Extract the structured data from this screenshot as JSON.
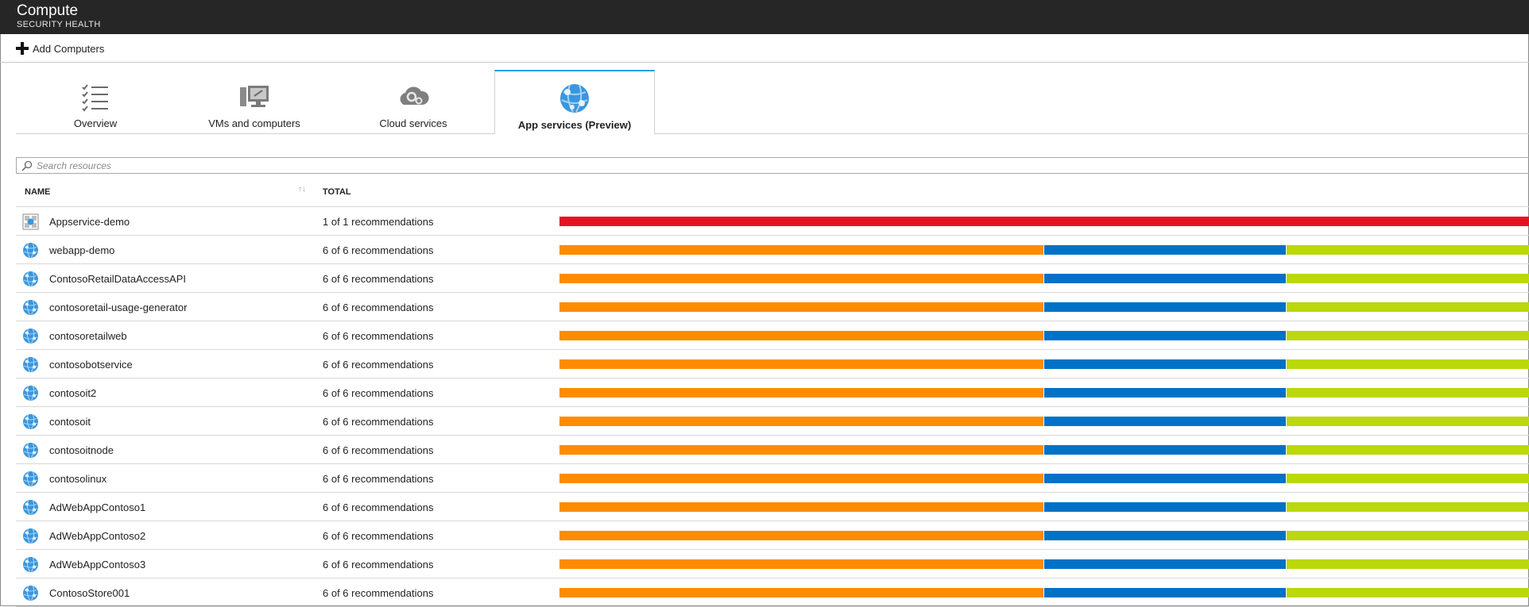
{
  "header": {
    "title": "Compute",
    "subtitle": "SECURITY HEALTH"
  },
  "toolbar": {
    "add_label": "Add Computers"
  },
  "tabs": [
    {
      "label": "Overview",
      "icon": "checklist-icon",
      "active": false
    },
    {
      "label": "VMs and computers",
      "icon": "computers-icon",
      "active": false
    },
    {
      "label": "Cloud services",
      "icon": "cloud-gears-icon",
      "active": false
    },
    {
      "label": "App services (Preview)",
      "icon": "app-service-globe-icon",
      "active": true
    }
  ],
  "search": {
    "placeholder": "Search resources",
    "value": ""
  },
  "table": {
    "columns": {
      "name": "NAME",
      "total": "TOTAL"
    },
    "severity_colors": {
      "high": "#e81123",
      "medium": "#ff8c00",
      "low": "#0072c6",
      "healthy": "#bad80a"
    },
    "rows": [
      {
        "name": "Appservice-demo",
        "total": "1 of 1 recommendations",
        "icon": "app-service-plan-icon",
        "segments": [
          {
            "level": "high",
            "fraction": 1.0
          }
        ]
      },
      {
        "name": "webapp-demo",
        "total": "6 of 6 recommendations",
        "icon": "web-app-globe-icon",
        "segments": [
          {
            "level": "medium",
            "fraction": 0.5
          },
          {
            "level": "low",
            "fraction": 0.25
          },
          {
            "level": "healthy",
            "fraction": 0.25
          }
        ]
      },
      {
        "name": "ContosoRetailDataAccessAPI",
        "total": "6 of 6 recommendations",
        "icon": "web-app-globe-icon",
        "segments": [
          {
            "level": "medium",
            "fraction": 0.5
          },
          {
            "level": "low",
            "fraction": 0.25
          },
          {
            "level": "healthy",
            "fraction": 0.25
          }
        ]
      },
      {
        "name": "contosoretail-usage-generator",
        "total": "6 of 6 recommendations",
        "icon": "web-app-globe-icon",
        "segments": [
          {
            "level": "medium",
            "fraction": 0.5
          },
          {
            "level": "low",
            "fraction": 0.25
          },
          {
            "level": "healthy",
            "fraction": 0.25
          }
        ]
      },
      {
        "name": "contosoretailweb",
        "total": "6 of 6 recommendations",
        "icon": "web-app-globe-icon",
        "segments": [
          {
            "level": "medium",
            "fraction": 0.5
          },
          {
            "level": "low",
            "fraction": 0.25
          },
          {
            "level": "healthy",
            "fraction": 0.25
          }
        ]
      },
      {
        "name": "contosobotservice",
        "total": "6 of 6 recommendations",
        "icon": "web-app-globe-icon",
        "segments": [
          {
            "level": "medium",
            "fraction": 0.5
          },
          {
            "level": "low",
            "fraction": 0.25
          },
          {
            "level": "healthy",
            "fraction": 0.25
          }
        ]
      },
      {
        "name": "contosoit2",
        "total": "6 of 6 recommendations",
        "icon": "web-app-globe-icon",
        "segments": [
          {
            "level": "medium",
            "fraction": 0.5
          },
          {
            "level": "low",
            "fraction": 0.25
          },
          {
            "level": "healthy",
            "fraction": 0.25
          }
        ]
      },
      {
        "name": "contosoit",
        "total": "6 of 6 recommendations",
        "icon": "web-app-globe-icon",
        "segments": [
          {
            "level": "medium",
            "fraction": 0.5
          },
          {
            "level": "low",
            "fraction": 0.25
          },
          {
            "level": "healthy",
            "fraction": 0.25
          }
        ]
      },
      {
        "name": "contosoitnode",
        "total": "6 of 6 recommendations",
        "icon": "web-app-globe-icon",
        "segments": [
          {
            "level": "medium",
            "fraction": 0.5
          },
          {
            "level": "low",
            "fraction": 0.25
          },
          {
            "level": "healthy",
            "fraction": 0.25
          }
        ]
      },
      {
        "name": "contosolinux",
        "total": "6 of 6 recommendations",
        "icon": "web-app-globe-icon",
        "segments": [
          {
            "level": "medium",
            "fraction": 0.5
          },
          {
            "level": "low",
            "fraction": 0.25
          },
          {
            "level": "healthy",
            "fraction": 0.25
          }
        ]
      },
      {
        "name": "AdWebAppContoso1",
        "total": "6 of 6 recommendations",
        "icon": "web-app-globe-icon",
        "segments": [
          {
            "level": "medium",
            "fraction": 0.5
          },
          {
            "level": "low",
            "fraction": 0.25
          },
          {
            "level": "healthy",
            "fraction": 0.25
          }
        ]
      },
      {
        "name": "AdWebAppContoso2",
        "total": "6 of 6 recommendations",
        "icon": "web-app-globe-icon",
        "segments": [
          {
            "level": "medium",
            "fraction": 0.5
          },
          {
            "level": "low",
            "fraction": 0.25
          },
          {
            "level": "healthy",
            "fraction": 0.25
          }
        ]
      },
      {
        "name": "AdWebAppContoso3",
        "total": "6 of 6 recommendations",
        "icon": "web-app-globe-icon",
        "segments": [
          {
            "level": "medium",
            "fraction": 0.5
          },
          {
            "level": "low",
            "fraction": 0.25
          },
          {
            "level": "healthy",
            "fraction": 0.25
          }
        ]
      },
      {
        "name": "ContosoStore001",
        "total": "6 of 6 recommendations",
        "icon": "web-app-globe-icon",
        "segments": [
          {
            "level": "medium",
            "fraction": 0.5
          },
          {
            "level": "low",
            "fraction": 0.25
          },
          {
            "level": "healthy",
            "fraction": 0.25
          }
        ]
      }
    ]
  }
}
